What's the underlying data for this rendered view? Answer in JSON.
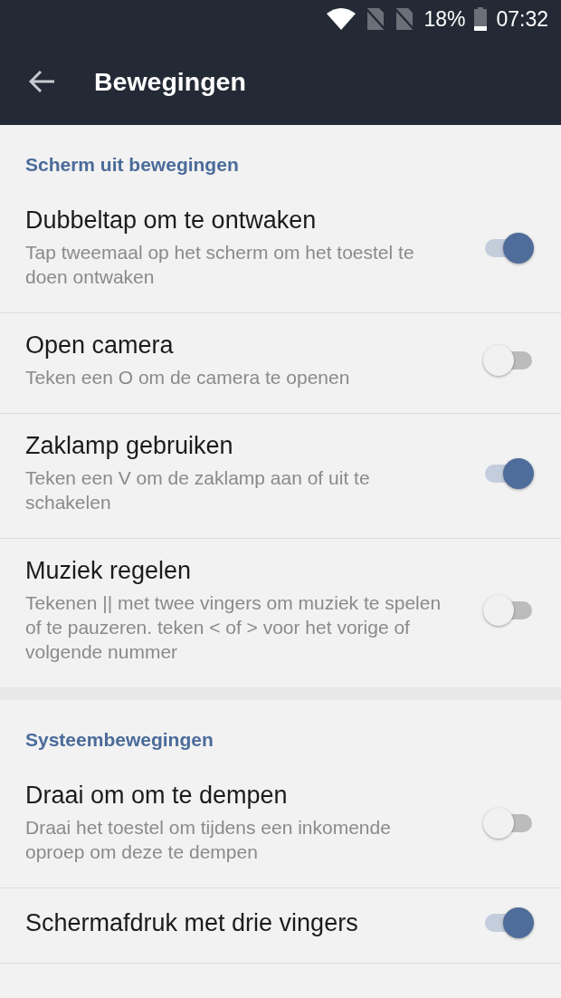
{
  "status_bar": {
    "battery": "18%",
    "time": "07:32"
  },
  "toolbar": {
    "title": "Bewegingen"
  },
  "sections": [
    {
      "header": "Scherm uit bewegingen",
      "items": [
        {
          "title": "Dubbeltap om te ontwaken",
          "subtitle": "Tap tweemaal op het scherm om het toestel te doen ontwaken",
          "on": true
        },
        {
          "title": "Open camera",
          "subtitle": "Teken een O om de camera te openen",
          "on": false
        },
        {
          "title": "Zaklamp gebruiken",
          "subtitle": "Teken een V om de zaklamp aan of uit te schakelen",
          "on": true
        },
        {
          "title": "Muziek regelen",
          "subtitle": "Tekenen || met twee vingers om muziek te spelen of te pauzeren. teken < of > voor het vorige of volgende nummer",
          "on": false
        }
      ]
    },
    {
      "header": "Systeembewegingen",
      "items": [
        {
          "title": "Draai om om te dempen",
          "subtitle": "Draai het toestel om tijdens een inkomende oproep om deze te dempen",
          "on": false
        },
        {
          "title": "Schermafdruk met drie vingers",
          "on": true
        }
      ]
    }
  ]
}
